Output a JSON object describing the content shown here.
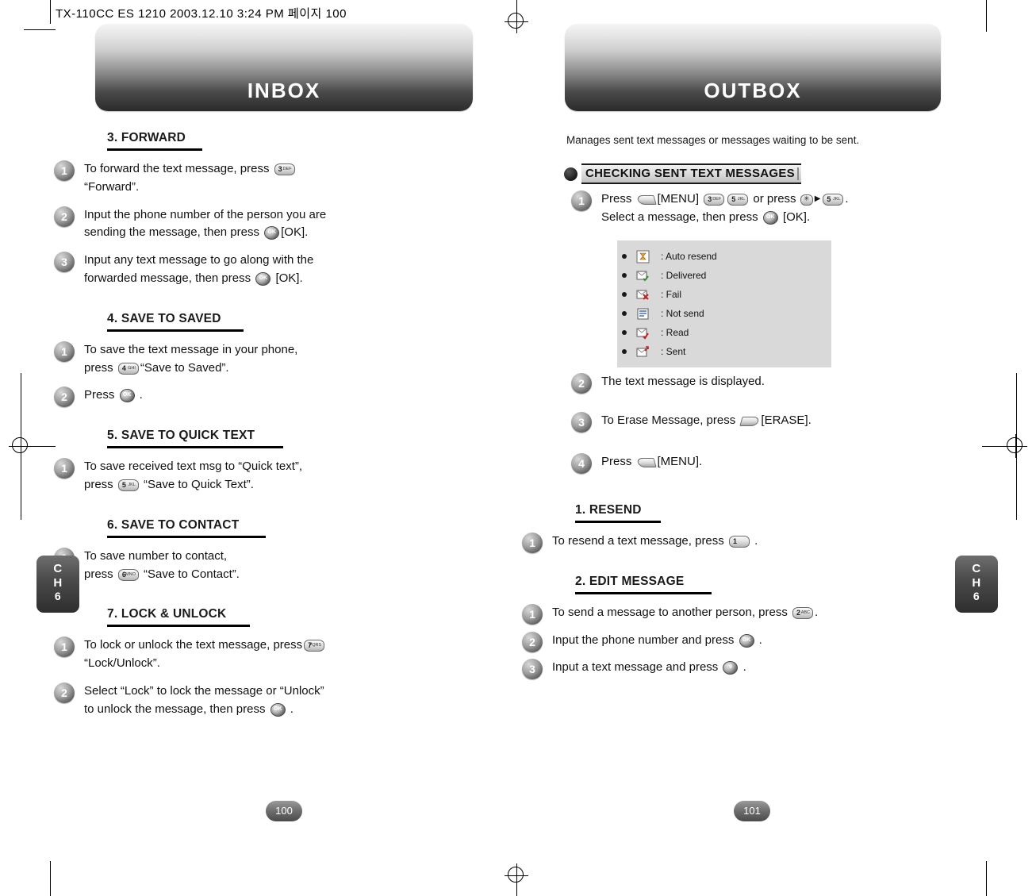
{
  "doc_header": "TX-110CC ES 1210  2003.12.10 3:24 PM  페이지 100",
  "left_page": {
    "banner_title": "INBOX",
    "page_number": "100",
    "chapter_tab": {
      "line1": "C",
      "line2": "H",
      "num": "6"
    },
    "sections": [
      {
        "title": "3. FORWARD",
        "steps": [
          {
            "num": "1",
            "parts": [
              {
                "t": "text",
                "v": "To forward the text message, press "
              },
              {
                "t": "key",
                "main": "3",
                "sub": "DEF"
              },
              {
                "t": "text",
                "v": " "
              },
              {
                "t": "br"
              },
              {
                "t": "text",
                "v": "“Forward”."
              }
            ]
          },
          {
            "num": "2",
            "parts": [
              {
                "t": "text",
                "v": "Input the phone number of the person you are"
              },
              {
                "t": "br"
              },
              {
                "t": "text",
                "v": "sending the message, then press "
              },
              {
                "t": "ok"
              },
              {
                "t": "text",
                "v": "[OK]."
              }
            ]
          },
          {
            "num": "3",
            "parts": [
              {
                "t": "text",
                "v": "Input any text message to go along with the"
              },
              {
                "t": "br"
              },
              {
                "t": "text",
                "v": "forwarded message, then press "
              },
              {
                "t": "ok"
              },
              {
                "t": "text",
                "v": " [OK]."
              }
            ]
          }
        ]
      },
      {
        "title": "4. SAVE TO SAVED",
        "steps": [
          {
            "num": "1",
            "parts": [
              {
                "t": "text",
                "v": "To save the text message in your phone,"
              },
              {
                "t": "br"
              },
              {
                "t": "text",
                "v": "press "
              },
              {
                "t": "key",
                "main": "4",
                "sub": "GHI"
              },
              {
                "t": "text",
                "v": "“Save to Saved”."
              }
            ]
          },
          {
            "num": "2",
            "parts": [
              {
                "t": "text",
                "v": "Press "
              },
              {
                "t": "ok"
              },
              {
                "t": "text",
                "v": " ."
              }
            ]
          }
        ]
      },
      {
        "title": "5. SAVE TO QUICK TEXT",
        "steps": [
          {
            "num": "1",
            "parts": [
              {
                "t": "text",
                "v": "To save received text msg to “Quick text”,"
              },
              {
                "t": "br"
              },
              {
                "t": "text",
                "v": "press "
              },
              {
                "t": "key",
                "main": "5",
                "sub": "JKL"
              },
              {
                "t": "text",
                "v": " “Save to Quick Text”."
              }
            ]
          }
        ]
      },
      {
        "title": "6. SAVE TO CONTACT",
        "steps": [
          {
            "num": "1",
            "parts": [
              {
                "t": "text",
                "v": "To save number to contact,"
              },
              {
                "t": "br"
              },
              {
                "t": "text",
                "v": "press "
              },
              {
                "t": "key",
                "main": "6",
                "sub": "MNO"
              },
              {
                "t": "text",
                "v": " “Save to Contact”."
              }
            ]
          }
        ]
      },
      {
        "title": "7. LOCK & UNLOCK",
        "steps": [
          {
            "num": "1",
            "parts": [
              {
                "t": "text",
                "v": "To lock or unlock the text message, press"
              },
              {
                "t": "key",
                "main": "7",
                "sub": "PQRS"
              },
              {
                "t": "br"
              },
              {
                "t": "text",
                "v": "“Lock/Unlock”."
              }
            ]
          },
          {
            "num": "2",
            "parts": [
              {
                "t": "text",
                "v": "Select “Lock” to lock the message or “Unlock”"
              },
              {
                "t": "br"
              },
              {
                "t": "text",
                "v": "to unlock the message, then press "
              },
              {
                "t": "ok"
              },
              {
                "t": "text",
                "v": " ."
              }
            ]
          }
        ]
      }
    ]
  },
  "right_page": {
    "banner_title": "OUTBOX",
    "page_number": "101",
    "chapter_tab": {
      "line1": "C",
      "line2": "H",
      "num": "6"
    },
    "intro": "Manages sent text messages or messages waiting to be sent.",
    "bullet_section_title": "CHECKING SENT TEXT MESSAGES",
    "checking_steps": [
      {
        "num": "1",
        "parts": [
          {
            "t": "text",
            "v": "Press "
          },
          {
            "t": "soft",
            "dir": "left"
          },
          {
            "t": "text",
            "v": "[MENU] "
          },
          {
            "t": "key",
            "main": "3",
            "sub": "DEF"
          },
          {
            "t": "key",
            "main": "5",
            "sub": "JKL"
          },
          {
            "t": "text",
            "v": " or press "
          },
          {
            "t": "star"
          },
          {
            "t": "arrow"
          },
          {
            "t": "key",
            "main": "5",
            "sub": "JKL"
          },
          {
            "t": "text",
            "v": "."
          },
          {
            "t": "br"
          },
          {
            "t": "text",
            "v": "Select a message, then press "
          },
          {
            "t": "ok"
          },
          {
            "t": "text",
            "v": " [OK]."
          }
        ]
      },
      {
        "num": "2",
        "parts": [
          {
            "t": "text",
            "v": "The text message is displayed."
          }
        ]
      },
      {
        "num": "3",
        "parts": [
          {
            "t": "text",
            "v": "To Erase Message, press "
          },
          {
            "t": "soft",
            "dir": "right"
          },
          {
            "t": "text",
            "v": "[ERASE]."
          }
        ]
      },
      {
        "num": "4",
        "parts": [
          {
            "t": "text",
            "v": "Press "
          },
          {
            "t": "soft",
            "dir": "left"
          },
          {
            "t": "text",
            "v": "[MENU]."
          }
        ]
      }
    ],
    "legend": [
      {
        "icon": "hourglass-icon",
        "label": ": Auto resend"
      },
      {
        "icon": "envelope-check-icon",
        "label": ": Delivered"
      },
      {
        "icon": "envelope-x-icon",
        "label": ": Fail"
      },
      {
        "icon": "envelope-lines-icon",
        "label": ": Not send"
      },
      {
        "icon": "envelope-read-icon",
        "label": ": Read"
      },
      {
        "icon": "envelope-arrow-icon",
        "label": ": Sent"
      }
    ],
    "sections": [
      {
        "title": "1. RESEND",
        "steps": [
          {
            "num": "1",
            "parts": [
              {
                "t": "text",
                "v": "To resend a text message, press "
              },
              {
                "t": "key",
                "main": "1",
                "sub": ""
              },
              {
                "t": "text",
                "v": " ."
              }
            ]
          }
        ]
      },
      {
        "title": "2. EDIT MESSAGE",
        "steps": [
          {
            "num": "1",
            "parts": [
              {
                "t": "text",
                "v": "To send a message to another person, press "
              },
              {
                "t": "key",
                "main": "2",
                "sub": "ABC"
              },
              {
                "t": "text",
                "v": "."
              }
            ]
          },
          {
            "num": "2",
            "parts": [
              {
                "t": "text",
                "v": "Input the phone number and press "
              },
              {
                "t": "ok"
              },
              {
                "t": "text",
                "v": " ."
              }
            ]
          },
          {
            "num": "3",
            "parts": [
              {
                "t": "text",
                "v": "Input a text message and press "
              },
              {
                "t": "key-round",
                "label": "9"
              },
              {
                "t": "text",
                "v": " ."
              }
            ]
          }
        ]
      }
    ]
  }
}
